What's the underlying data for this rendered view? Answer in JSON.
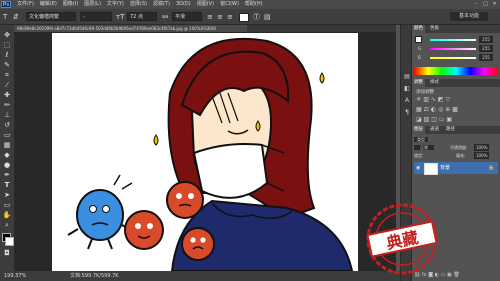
{
  "app": {
    "logo": "Ps"
  },
  "menu": [
    "文件(F)",
    "编辑(E)",
    "图像(I)",
    "图层(L)",
    "文字(Y)",
    "选择(S)",
    "滤镜(T)",
    "3D(D)",
    "视图(V)",
    "窗口(W)",
    "帮助(H)"
  ],
  "window_controls": [
    "–",
    "□",
    "✕"
  ],
  "options": {
    "font_family": "文化偏楷简繁",
    "font_style": "-",
    "font_size": "72 点",
    "antialias": "平滑",
    "workspace": "基本功能"
  },
  "document": {
    "tab_title": "98c89e8c201099l.a8d7c73d0d5d6c89-503dd8b5b9b95ed74789ae083c4f67ab.jpg @ 100%(RGB/8)"
  },
  "status": {
    "zoom": "199.37%",
    "doc_info": "文档:599.7K/599.7K"
  },
  "panels": {
    "color_tabs": [
      "颜色",
      "色板"
    ],
    "color_labels": [
      "R",
      "G",
      "B"
    ],
    "color_values": [
      "255",
      "255",
      "255"
    ],
    "adjust_tabs": [
      "调整",
      "样式"
    ],
    "adjust_title": "添加调整",
    "layer_tabs": [
      "图层",
      "通道",
      "路径"
    ],
    "layer_kind": "类型",
    "blend_mode": "正常",
    "opacity_label": "不透明度:",
    "opacity": "100%",
    "lock_label": "锁定:",
    "fill_label": "填充:",
    "fill": "100%",
    "layer_name": "背景",
    "colors": {
      "accent": "#3e6fb0",
      "red_track": "#ff0000",
      "green_track": "#00ff00",
      "blue_track": "#0000ff"
    }
  },
  "stamp": {
    "text": "典藏"
  }
}
